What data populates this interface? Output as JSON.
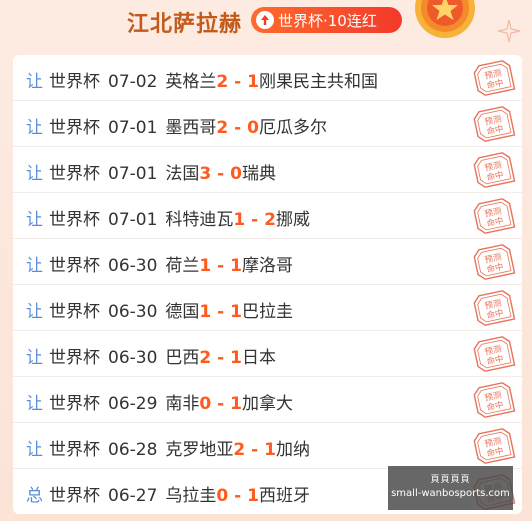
{
  "header": {
    "title": "江北萨拉赫",
    "streak_label": "世界杯·10连红"
  },
  "stamp_text": "预测命中",
  "matches": [
    {
      "tag": "让",
      "competition": "世界杯",
      "date": "07-02",
      "home": "英格兰",
      "home_score": "2",
      "away_score": "1",
      "away": "刚果民主共和国"
    },
    {
      "tag": "让",
      "competition": "世界杯",
      "date": "07-01",
      "home": "墨西哥",
      "home_score": "2",
      "away_score": "0",
      "away": "厄瓜多尔"
    },
    {
      "tag": "让",
      "competition": "世界杯",
      "date": "07-01",
      "home": "法国",
      "home_score": "3",
      "away_score": "0",
      "away": "瑞典"
    },
    {
      "tag": "让",
      "competition": "世界杯",
      "date": "07-01",
      "home": "科特迪瓦",
      "home_score": "1",
      "away_score": "2",
      "away": "挪威"
    },
    {
      "tag": "让",
      "competition": "世界杯",
      "date": "06-30",
      "home": "荷兰",
      "home_score": "1",
      "away_score": "1",
      "away": "摩洛哥"
    },
    {
      "tag": "让",
      "competition": "世界杯",
      "date": "06-30",
      "home": "德国",
      "home_score": "1",
      "away_score": "1",
      "away": "巴拉圭"
    },
    {
      "tag": "让",
      "competition": "世界杯",
      "date": "06-30",
      "home": "巴西",
      "home_score": "2",
      "away_score": "1",
      "away": "日本"
    },
    {
      "tag": "让",
      "competition": "世界杯",
      "date": "06-29",
      "home": "南非",
      "home_score": "0",
      "away_score": "1",
      "away": "加拿大"
    },
    {
      "tag": "让",
      "competition": "世界杯",
      "date": "06-28",
      "home": "克罗地亚",
      "home_score": "2",
      "away_score": "1",
      "away": "加纳"
    },
    {
      "tag": "总",
      "competition": "世界杯",
      "date": "06-27",
      "home": "乌拉圭",
      "home_score": "0",
      "away_score": "1",
      "away": "西班牙"
    }
  ],
  "watermark": {
    "line1": "頁頁頁頁",
    "line2": "small-wanbosports.com"
  },
  "colors": {
    "accent": "#ff5a1f",
    "tag": "#5a8ed6",
    "stamp": "#e8735a",
    "title": "#c25a1c"
  }
}
